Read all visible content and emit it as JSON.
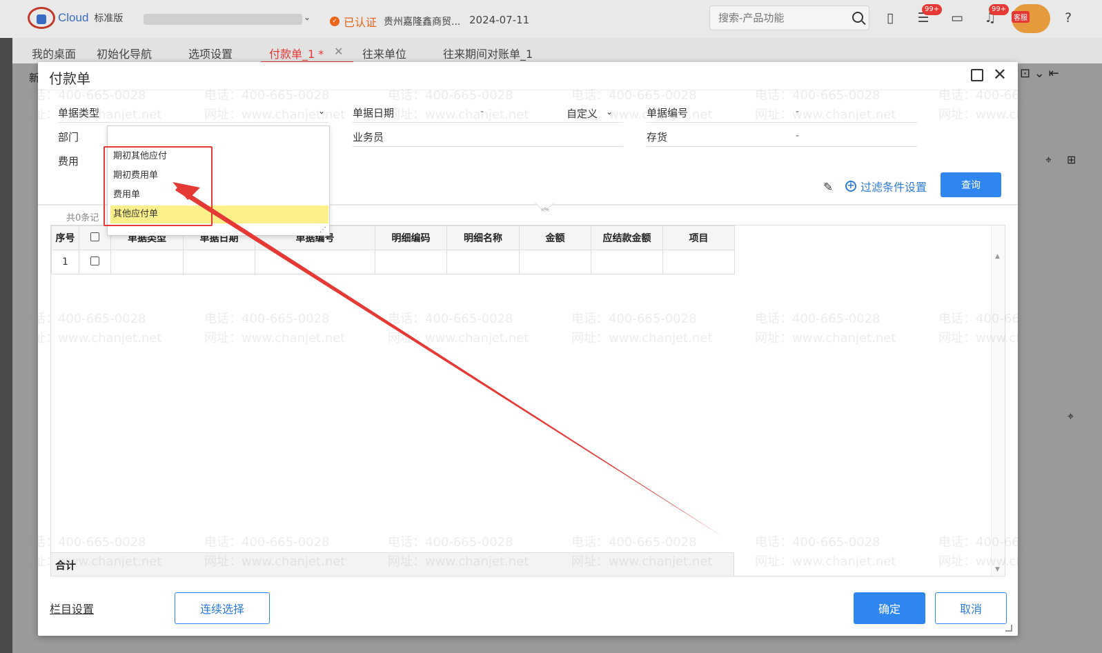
{
  "header": {
    "logo_text": "Cloud",
    "edition": "标准版",
    "cert_label": "已认证",
    "company": "贵州嘉隆鑫商贸...",
    "date": "2024-07-11",
    "search_placeholder": "搜索-产品功能",
    "todo_badge": "99+",
    "bell_badge": "99+",
    "support_label": "客服"
  },
  "tabs": [
    {
      "label": "我的桌面"
    },
    {
      "label": "初始化导航"
    },
    {
      "label": "选项设置"
    },
    {
      "label": "付款单_1 *"
    },
    {
      "label": "往来单位"
    },
    {
      "label": "往来期间对账单_1"
    }
  ],
  "background": {
    "new_label": "新"
  },
  "modal": {
    "title": "付款单",
    "fields": {
      "doc_type": "单据类型",
      "doc_date": "单据日期",
      "doc_date_value": "-",
      "custom": "自定义",
      "doc_no": "单据编号",
      "doc_no_value": "-",
      "dept": "部门",
      "salesperson": "业务员",
      "inventory": "存货",
      "inventory_value": "-",
      "expense": "费用"
    },
    "filter_settings": "过滤条件设置",
    "query": "查询",
    "record_count": "共0条记",
    "table": {
      "headers": [
        "序号",
        "",
        "单据类型",
        "单据日期",
        "单据编号",
        "明细编码",
        "明细名称",
        "金额",
        "应结款金额",
        "项目"
      ],
      "rows": [
        [
          "1",
          "",
          "",
          "",
          "",
          "",
          "",
          "",
          "",
          ""
        ]
      ],
      "total_label": "合计"
    },
    "column_settings": "栏目设置",
    "continuous_select": "连续选择",
    "confirm": "确定",
    "cancel": "取消"
  },
  "dropdown": {
    "options": [
      "期初其他应付",
      "期初费用单",
      "费用单",
      "其他应付单"
    ],
    "selected": "其他应付单"
  },
  "watermark": {
    "phone": "电话：400-665-0028",
    "site": "网址：www.chanjet.net"
  },
  "colors": {
    "accent": "#2f86f0",
    "active_tab": "#e53935",
    "annotation": "#e53935",
    "selected_option": "#fbf08a"
  }
}
